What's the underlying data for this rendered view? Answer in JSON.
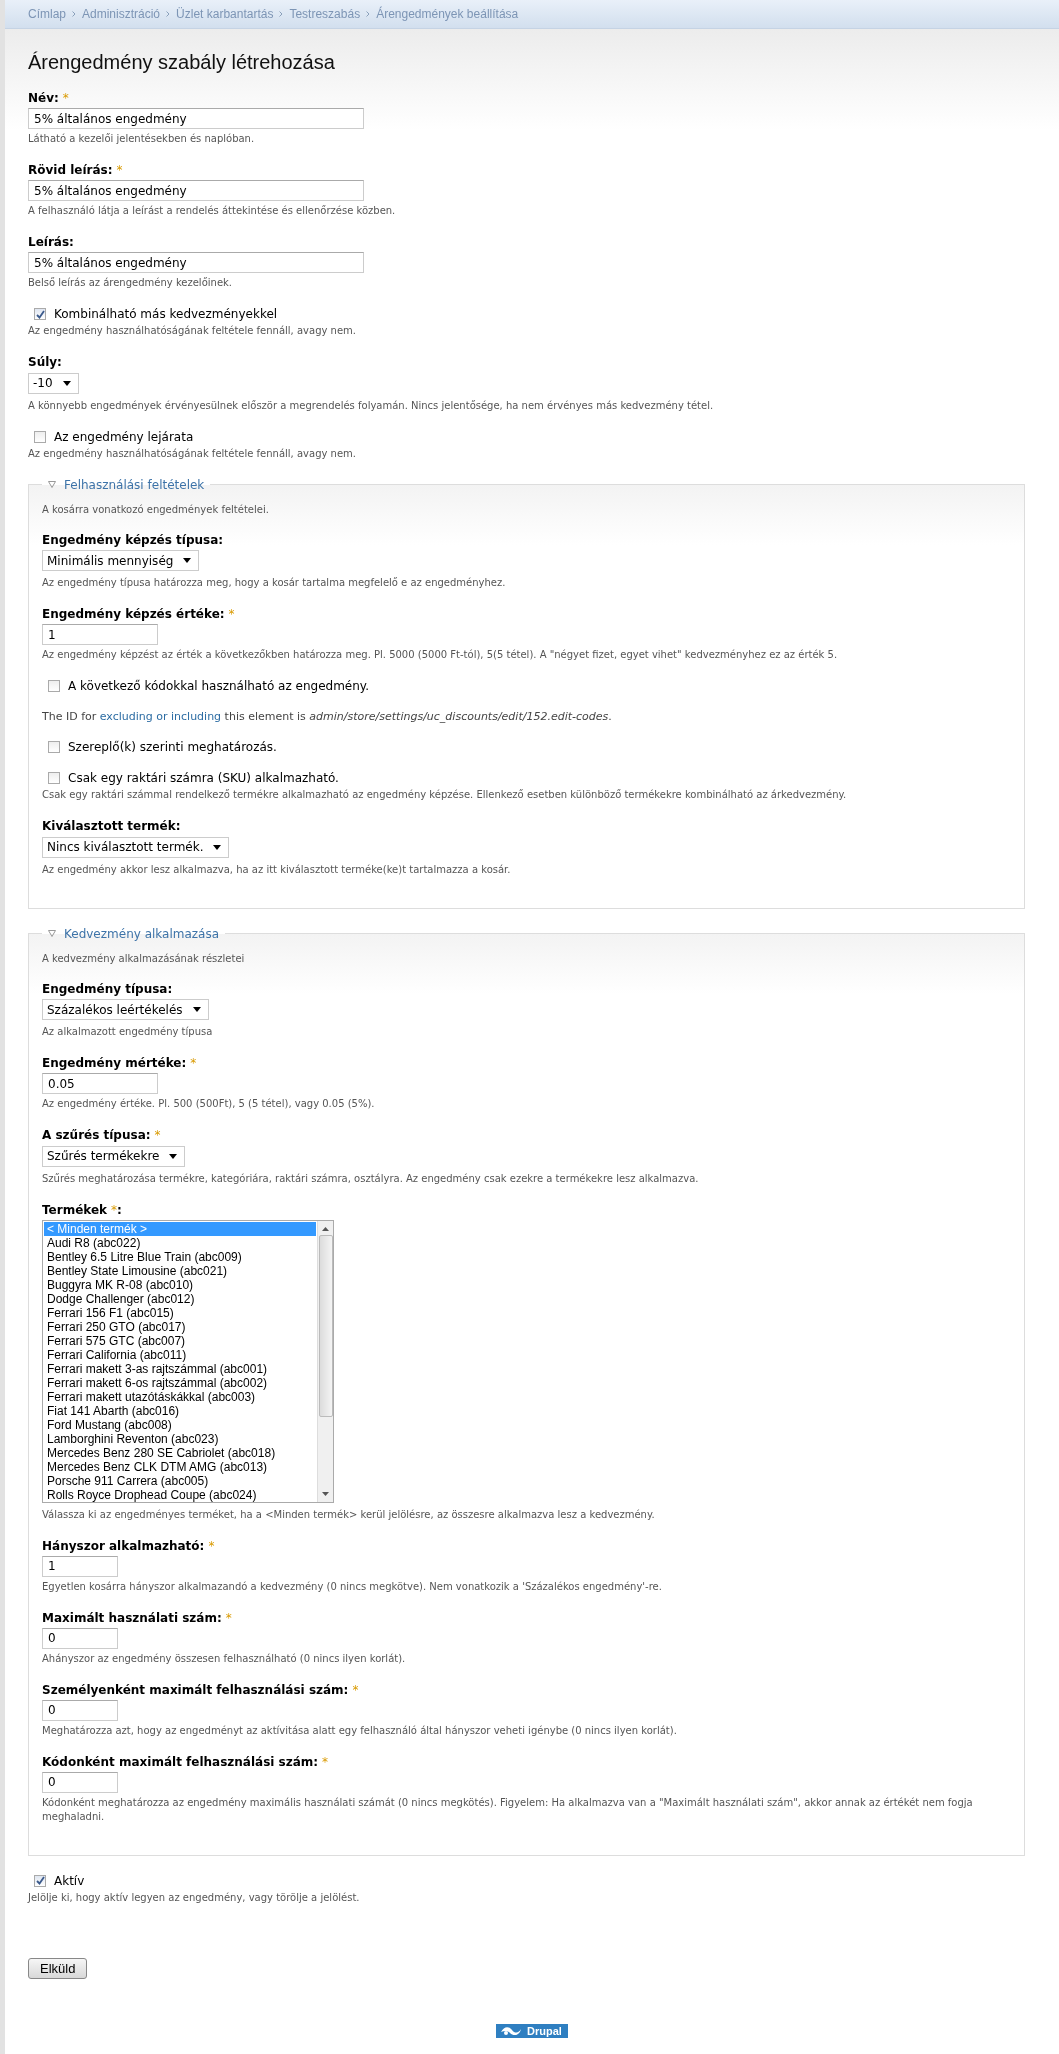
{
  "breadcrumb": [
    "Címlap",
    "Adminisztráció",
    "Üzlet karbantartás",
    "Testreszabás",
    "Árengedmények beállítása"
  ],
  "title": "Árengedmény szabály létrehozása",
  "form": [
    {
      "kind": "text",
      "label": "Név:",
      "mark": "*",
      "value": "5% általános engedmény",
      "description": "Látható a kezelői jelentésekben és naplóban."
    },
    {
      "kind": "text",
      "label": "Rövid leírás:",
      "mark": "*",
      "value": "5% általános engedmény",
      "description": "A felhasználó látja a leírást a rendelés áttekintése és ellenőrzése közben."
    },
    {
      "kind": "text",
      "label": "Leírás:",
      "value": "5% általános engedmény",
      "description": "Belső leírás az árengedmény kezelőinek."
    },
    {
      "kind": "checkbox",
      "label": "Kombinálható más kedvezményekkel",
      "checked": true,
      "description": "Az engedmény használhatóságának feltétele fennáll, avagy nem."
    },
    {
      "kind": "select",
      "label": "Súly:",
      "value": "-10",
      "description": "A könnyebb engedmények érvényesülnek először a megrendelés folyamán. Nincs jelentősége, ha nem érvényes más kedvezmény tétel."
    },
    {
      "kind": "checkbox",
      "label": "Az engedmény lejárata",
      "checked": false,
      "description": "Az engedmény használhatóságának feltétele fennáll, avagy nem."
    },
    {
      "kind": "fieldset",
      "legend": "Felhasználási feltételek",
      "expanded": true,
      "description": "A kosárra vonatkozó engedmények feltételei.",
      "items": [
        {
          "kind": "select",
          "label": "Engedmény képzés típusa:",
          "value": "Minimális mennyiség",
          "description": "Az engedmény típusa határozza meg, hogy a kosár tartalma megfelelő e az engedményhez."
        },
        {
          "kind": "amount",
          "label": "Engedmény képzés értéke:",
          "mark": "*",
          "value": "1",
          "description": "Az engedmény képzést az érték a következőkben határozza meg. Pl. 5000 (5000 Ft-tól), 5(5 tétel). A \"négyet fizet, egyet vihet\" kedvezményhez ez az érték 5."
        },
        {
          "kind": "checkbox",
          "label": "A következő kódokkal használható az engedmény.",
          "checked": false
        },
        {
          "kind": "note",
          "before": "The ID for",
          "link": "excluding or including",
          "after": "this element is *admin/store/settings/uc_discounts/edit/152.edit-codes*."
        },
        {
          "kind": "checkbox",
          "label": "Szereplő(k) szerinti meghatározás.",
          "checked": false
        },
        {
          "kind": "checkbox",
          "label": "Csak egy raktári számra (SKU) alkalmazható.",
          "checked": false,
          "description": "Csak egy raktári számmal rendelkező termékre alkalmazható az engedmény képzése. Ellenkező esetben különböző termékekre kombinálható az árkedvezmény."
        },
        {
          "kind": "select",
          "label": "Kiválasztott termék:",
          "value": "Nincs kiválasztott termék.",
          "description": "Az engedmény akkor lesz alkalmazva, ha az itt kiválasztott terméke(ke)t tartalmazza a kosár."
        }
      ]
    },
    {
      "kind": "fieldset",
      "legend": "Kedvezmény alkalmazása",
      "expanded": true,
      "description": "A kedvezmény alkalmazásának részletei",
      "items": [
        {
          "kind": "select",
          "label": "Engedmény típusa:",
          "value": "Százalékos leértékelés",
          "description": "Az alkalmazott engedmény típusa"
        },
        {
          "kind": "amount",
          "label": "Engedmény mértéke:",
          "mark": "*",
          "value": "0.05",
          "description": "Az engedmény értéke. Pl. 500 (500Ft), 5 (5 tétel), vagy 0.05 (5%)."
        },
        {
          "kind": "select",
          "label": "A szűrés típusa:",
          "mark": "*",
          "value": "Szűrés termékekre",
          "description": "Szűrés meghatározása termékre, kategóriára, raktári számra, osztályra. Az engedmény csak ezekre a termékekre lesz alkalmazva."
        },
        {
          "kind": "listbox",
          "label": "Termékek",
          "mark": "*",
          "after": ":",
          "description": "Válassza ki az engedményes terméket, ha a <Minden termék> kerül jelölésre, az összesre alkalmazva lesz a kedvezmény.",
          "options": [
            {
              "label": "< Minden termék >",
              "selected": true
            },
            {
              "label": "Audi R8 (abc022)",
              "selected": false
            },
            {
              "label": "Bentley 6.5 Litre Blue Train (abc009)",
              "selected": false
            },
            {
              "label": "Bentley State Limousine (abc021)",
              "selected": false
            },
            {
              "label": "Buggyra MK R-08 (abc010)",
              "selected": false
            },
            {
              "label": "Dodge Challenger (abc012)",
              "selected": false
            },
            {
              "label": "Ferrari 156 F1 (abc015)",
              "selected": false
            },
            {
              "label": "Ferrari 250 GTO (abc017)",
              "selected": false
            },
            {
              "label": "Ferrari 575 GTC (abc007)",
              "selected": false
            },
            {
              "label": "Ferrari California (abc011)",
              "selected": false
            },
            {
              "label": "Ferrari makett 3-as rajtszámmal (abc001)",
              "selected": false
            },
            {
              "label": "Ferrari makett 6-os rajtszámmal (abc002)",
              "selected": false
            },
            {
              "label": "Ferrari makett utazótáskákkal (abc003)",
              "selected": false
            },
            {
              "label": "Fiat 141 Abarth (abc016)",
              "selected": false
            },
            {
              "label": "Ford Mustang (abc008)",
              "selected": false
            },
            {
              "label": "Lamborghini Reventon (abc023)",
              "selected": false
            },
            {
              "label": "Mercedes Benz 280 SE Cabriolet (abc018)",
              "selected": false
            },
            {
              "label": "Mercedes Benz CLK DTM AMG (abc013)",
              "selected": false
            },
            {
              "label": "Porsche 911 Carrera (abc005)",
              "selected": false
            },
            {
              "label": "Rolls Royce Drophead Coupe (abc024)",
              "selected": false
            }
          ]
        },
        {
          "kind": "count",
          "label": "Hányszor alkalmazható:",
          "mark": "*",
          "value": "1",
          "description": "Egyetlen kosárra hányszor alkalmazandó a kedvezmény (0 nincs megkötve). Nem vonatkozik a 'Százalékos engedmény'-re."
        },
        {
          "kind": "count",
          "label": "Maximált használati szám:",
          "mark": "*",
          "value": "0",
          "description": "Ahányszor az engedmény összesen felhasználható (0 nincs ilyen korlát)."
        },
        {
          "kind": "count",
          "label": "Személyenként maximált felhasználási szám:",
          "mark": "*",
          "value": "0",
          "description": "Meghatározza azt, hogy az engedményt az aktívitása alatt egy felhasználó által hányszor veheti igénybe (0 nincs ilyen korlát)."
        },
        {
          "kind": "count",
          "label": "Kódonként maximált felhasználási szám:",
          "mark": "*",
          "value": "0",
          "description": "Kódonként meghatározza az engedmény maximális használati számát (0 nincs megkötés). Figyelem: Ha alkalmazva van a \"Maximált használati szám\", akkor annak az értékét nem fogja meghaladni."
        }
      ]
    },
    {
      "kind": "checkbox",
      "label": "Aktív",
      "checked": true,
      "description": "Jelölje ki, hogy aktív legyen az engedmény, vagy törölje a jelölést."
    },
    {
      "kind": "button",
      "label": "Elküld"
    }
  ],
  "footer_badge": "Drupal"
}
